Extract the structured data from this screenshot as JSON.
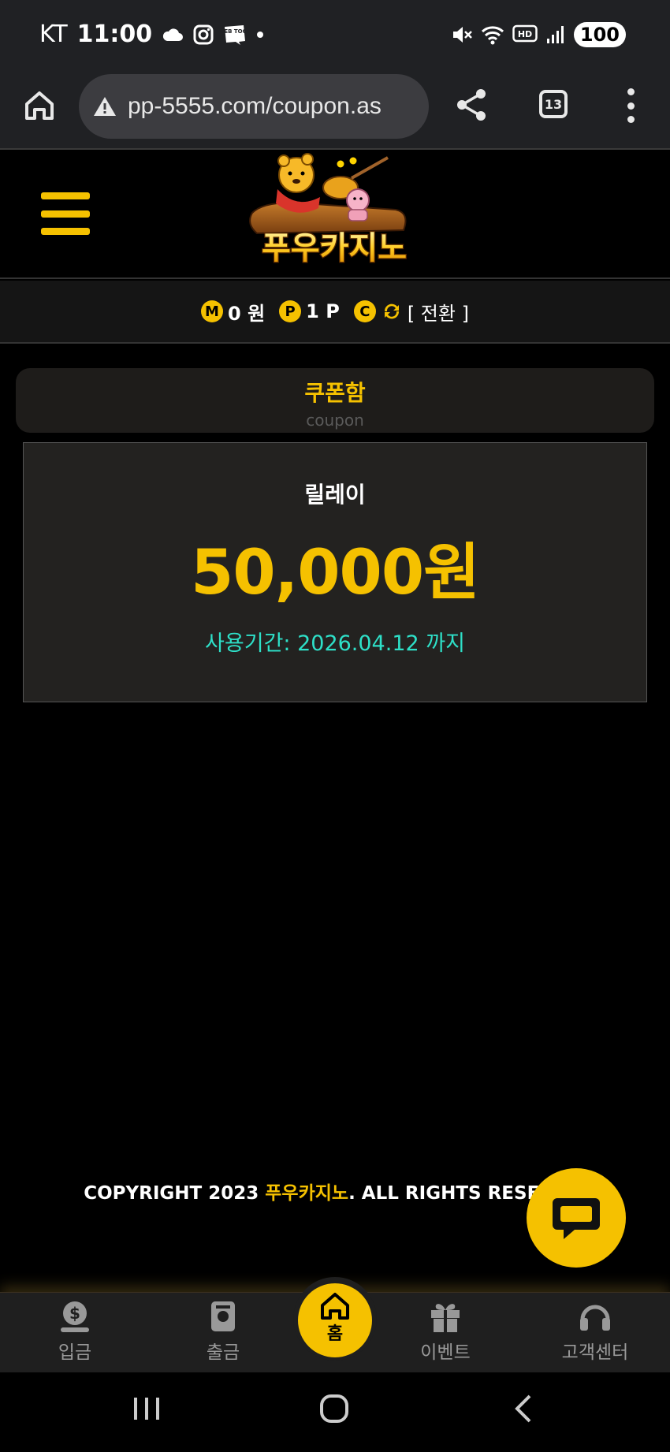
{
  "status_bar": {
    "carrier": "KT",
    "time": "11:00",
    "battery": "100",
    "icons": [
      "cloud-icon",
      "instagram-icon",
      "webtoon-icon",
      "dot-icon",
      "mute-icon",
      "wifi-icon",
      "hd-icon",
      "signal-icon"
    ],
    "webtoon_label": "WEB TOON",
    "hd_label": "HD"
  },
  "browser": {
    "url": "pp-5555.com/coupon.as",
    "tab_count": "13",
    "icons": [
      "home-icon",
      "warning-icon",
      "share-icon",
      "tabs-icon",
      "more-icon"
    ]
  },
  "header": {
    "logo_text": "푸우카지노",
    "menu_icon": "hamburger-icon"
  },
  "balance": {
    "money_badge": "M",
    "money_value": "0 원",
    "point_badge": "P",
    "point_value": "1 P",
    "casino_badge": "C",
    "switch_label": "[ 전환 ]"
  },
  "coupon_box": {
    "title": "쿠폰함",
    "subtitle": "coupon"
  },
  "coupon": {
    "name": "릴레이",
    "amount": "50,000원",
    "period": "사용기간: 2026.04.12 까지"
  },
  "footer": {
    "copyright_prefix": "COPYRIGHT 2023 ",
    "brand": "푸우카지노",
    "copyright_suffix": ". ALL RIGHTS RESERV"
  },
  "bottom_nav": {
    "items": [
      {
        "label": "입금",
        "icon": "deposit-icon"
      },
      {
        "label": "출금",
        "icon": "withdraw-icon"
      },
      {
        "label": "홈",
        "icon": "home-icon"
      },
      {
        "label": "이벤트",
        "icon": "gift-icon"
      },
      {
        "label": "고객센터",
        "icon": "headset-icon"
      }
    ]
  },
  "colors": {
    "accent": "#f5c100",
    "period_text": "#2ee0c8",
    "background": "#000000"
  }
}
